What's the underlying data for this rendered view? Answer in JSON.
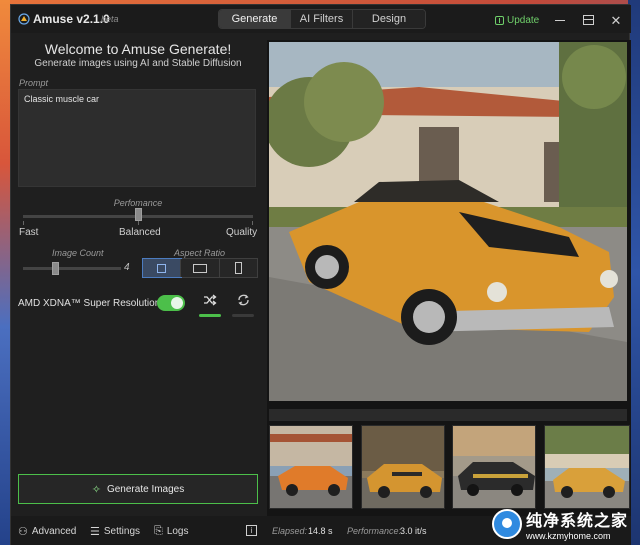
{
  "titlebar": {
    "app_name": "Amuse v2.1.0",
    "beta_label": "beta",
    "tabs": [
      {
        "label": "Generate",
        "active": true
      },
      {
        "label": "AI Filters",
        "active": false
      },
      {
        "label": "Design",
        "active": false
      }
    ],
    "update_label": "Update"
  },
  "header": {
    "welcome": "Welcome to Amuse Generate!",
    "subtitle": "Generate images using AI and Stable Diffusion"
  },
  "prompt": {
    "label": "Prompt",
    "value": "Classic muscle car"
  },
  "performance": {
    "label": "Perfomance",
    "options": [
      "Fast",
      "Balanced",
      "Quality"
    ],
    "selected": "Balanced"
  },
  "image_count": {
    "label": "Image Count",
    "value": "4"
  },
  "aspect_ratio": {
    "label": "Aspect Ratio",
    "options": [
      "square",
      "landscape",
      "portrait"
    ],
    "selected": "square"
  },
  "super_resolution": {
    "label": "AMD XDNA™ Super Resolution",
    "enabled": true
  },
  "modes": {
    "shuffle_active": true,
    "repeat_active": false
  },
  "generate_button": "Generate Images",
  "bottom_bar": {
    "advanced": "Advanced",
    "settings": "Settings",
    "logs": "Logs",
    "elapsed_label": "Elapsed:",
    "elapsed_value": "14.8 s",
    "performance_label": "Performance:",
    "performance_value": "3.0 it/s"
  },
  "watermark": {
    "title": "纯净系统之家",
    "url": "www.kzmyhome.com"
  },
  "colors": {
    "accent_green": "#4cbf4a",
    "selection_blue": "#4c7cc0",
    "car_body": "#d9952c"
  }
}
